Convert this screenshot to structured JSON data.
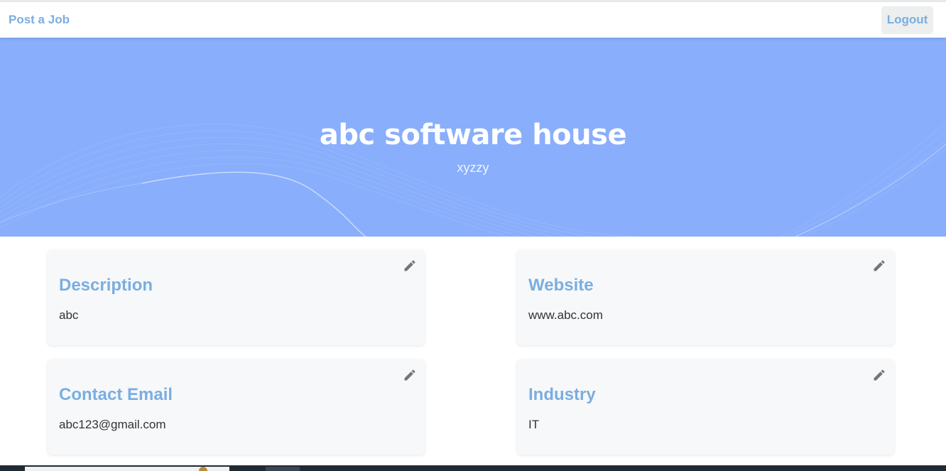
{
  "navbar": {
    "brand_link": "Post a Job",
    "logout_label": "Logout"
  },
  "hero": {
    "company_name": "abc software house",
    "tagline": "xyzzy",
    "background_color": "#89aefc"
  },
  "cards": [
    {
      "title": "Description",
      "value": "abc",
      "edit_icon": "pencil-icon"
    },
    {
      "title": "Website",
      "value": "www.abc.com",
      "edit_icon": "pencil-icon"
    },
    {
      "title": "Contact Email",
      "value": "abc123@gmail.com",
      "edit_icon": "pencil-icon"
    },
    {
      "title": "Industry",
      "value": "IT",
      "edit_icon": "pencil-icon"
    }
  ],
  "colors": {
    "accent": "#7aaee0",
    "card_bg": "#f7f8fa",
    "icon": "#757575"
  }
}
